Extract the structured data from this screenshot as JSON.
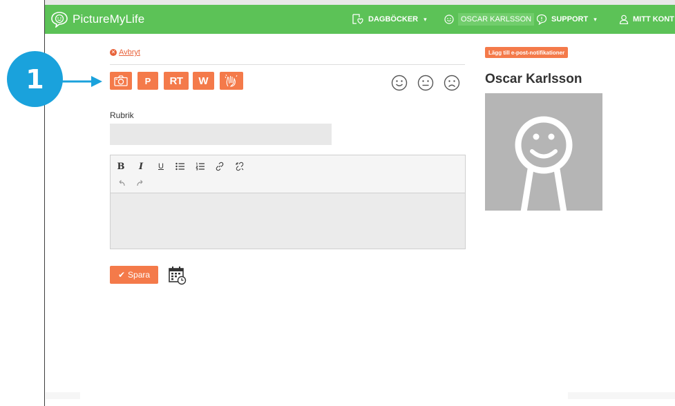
{
  "navbar": {
    "brand": "PictureMyLife",
    "diaries": "DAGBÖCKER",
    "user": "OSCAR KARLSSON",
    "support": "SUPPORT",
    "account": "MITT KONT"
  },
  "entry": {
    "cancel": "Avbryt",
    "tools": [
      {
        "id": "camera",
        "label": ""
      },
      {
        "id": "p",
        "label": "P"
      },
      {
        "id": "rt",
        "label": "RT"
      },
      {
        "id": "w",
        "label": "W"
      },
      {
        "id": "hands",
        "label": ""
      }
    ],
    "moods": [
      "happy-face-icon",
      "neutral-face-icon",
      "sad-face-icon"
    ],
    "title_label": "Rubrik",
    "title_value": "",
    "body_value": "",
    "save": "Spara"
  },
  "editor_toolbar": [
    "bold",
    "italic",
    "underline",
    "bullet-list",
    "numbered-list",
    "link",
    "unlink",
    "undo",
    "redo"
  ],
  "sidebar": {
    "notifications_button": "Lägg till e-post-notifikationer",
    "profile_name": "Oscar Karlsson"
  },
  "callout": {
    "number": "1"
  },
  "colors": {
    "brand_green": "#5cc257",
    "accent_orange": "#f47a4a",
    "callout_blue": "#1aa2dc"
  }
}
